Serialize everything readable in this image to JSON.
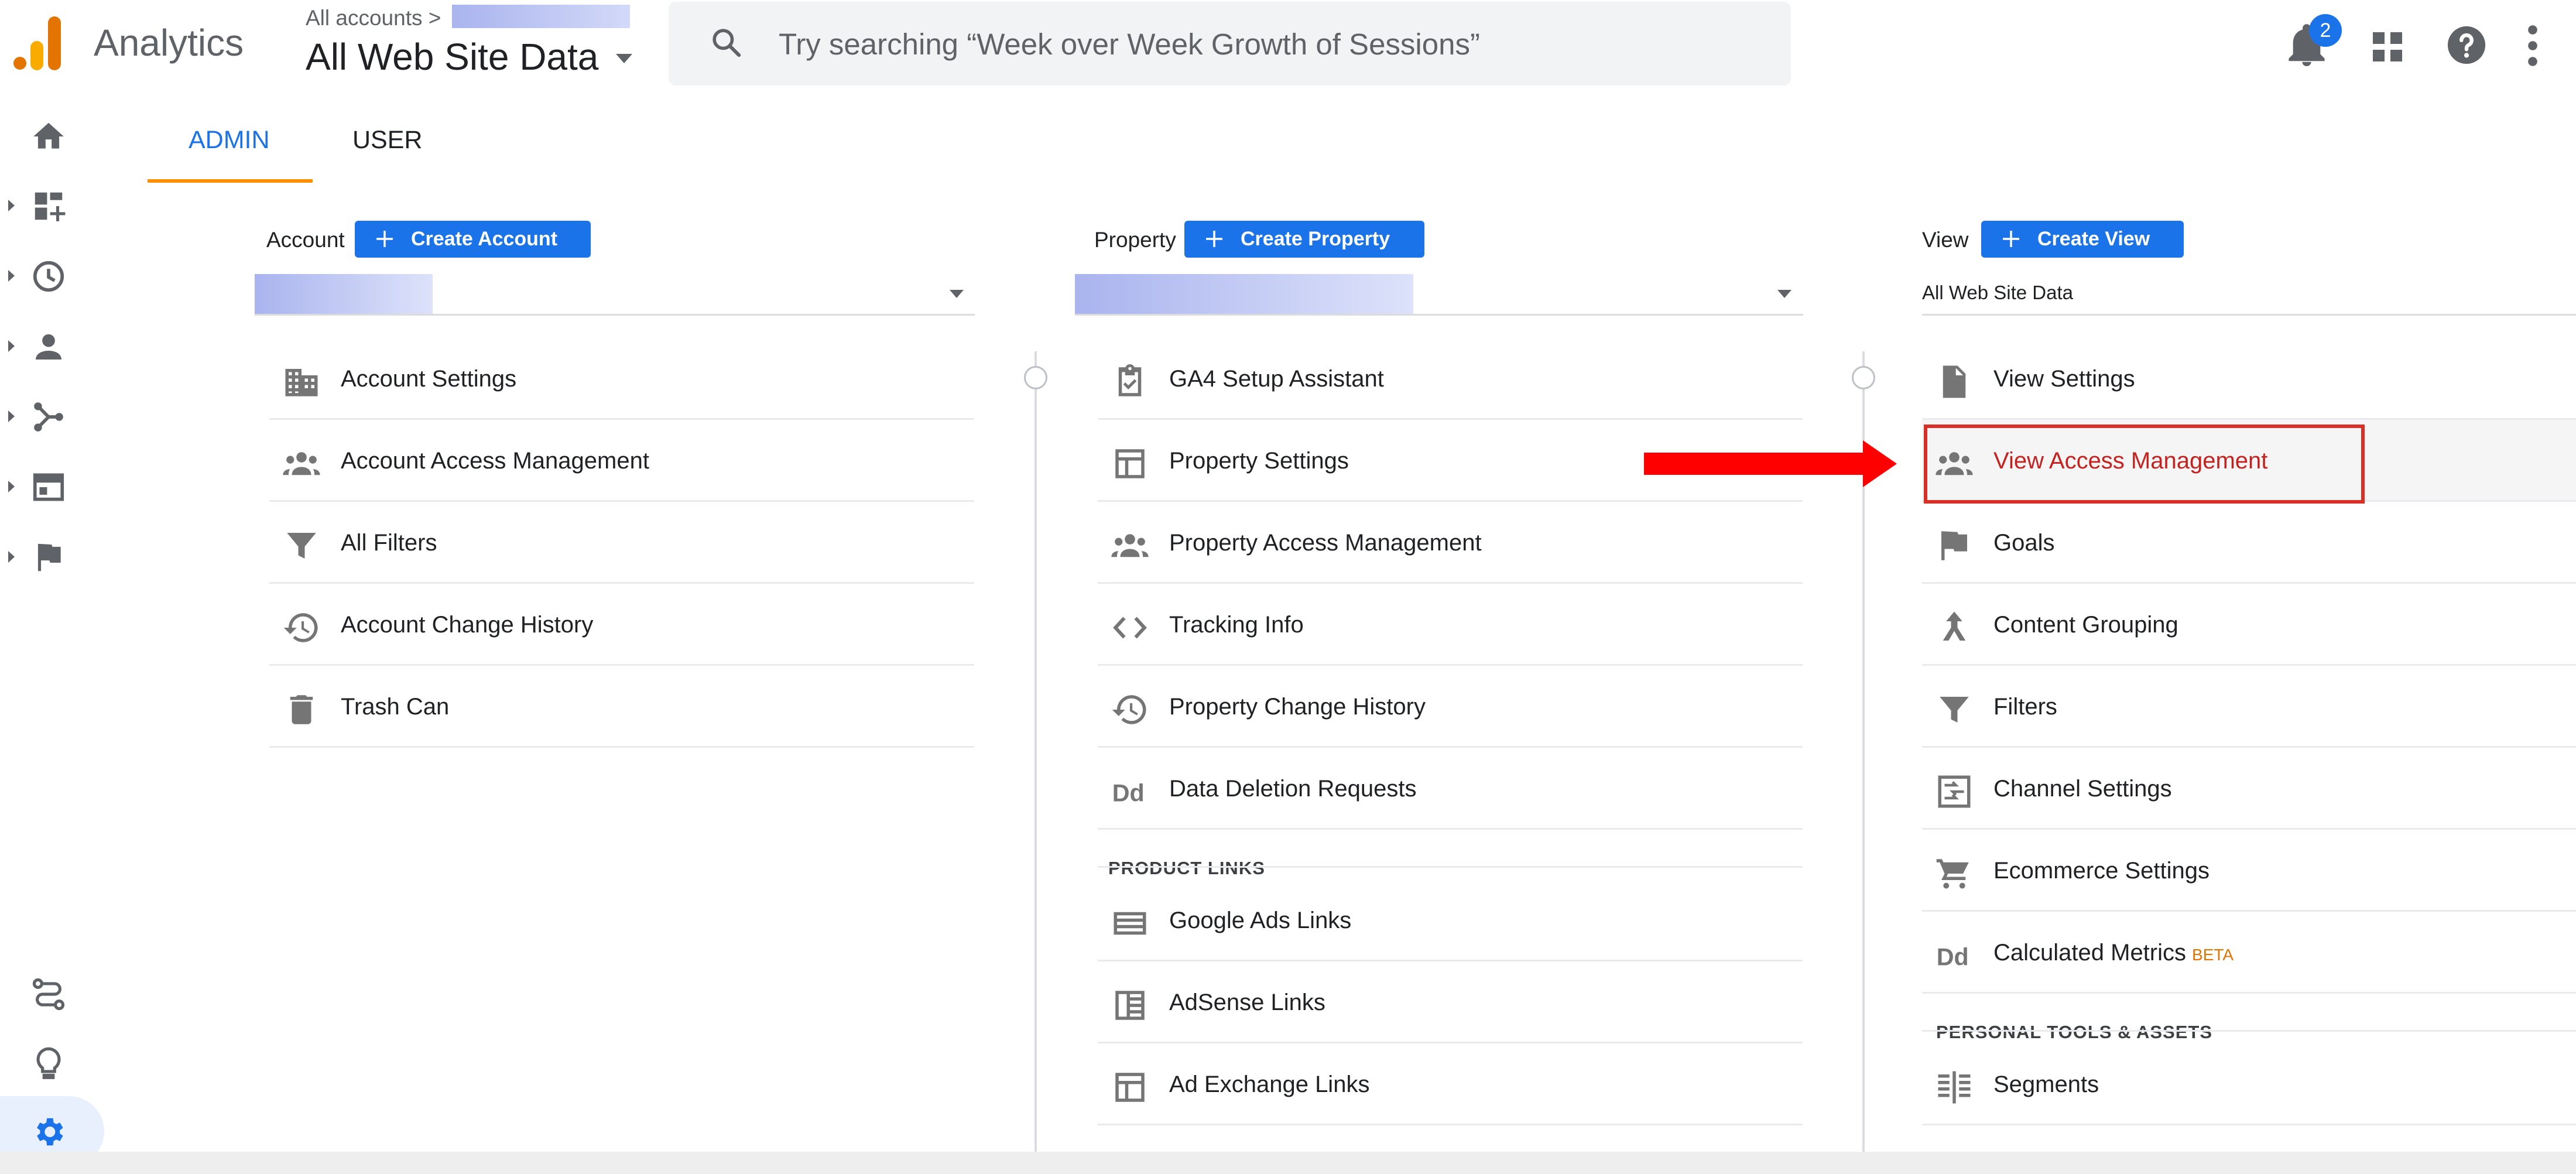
{
  "header": {
    "app_name": "Analytics",
    "breadcrumb": "All accounts >",
    "current_view": "All Web Site Data",
    "search_placeholder": "Try searching “Week over Week Growth of Sessions”",
    "notification_count": "2"
  },
  "tabs": [
    {
      "label": "ADMIN",
      "active": true
    },
    {
      "label": "USER",
      "active": false
    }
  ],
  "account_column": {
    "label": "Account",
    "create_label": "Create Account",
    "items": [
      {
        "label": "Account Settings",
        "icon": "building-icon"
      },
      {
        "label": "Account Access Management",
        "icon": "people-icon"
      },
      {
        "label": "All Filters",
        "icon": "filter-icon"
      },
      {
        "label": "Account Change History",
        "icon": "history-icon"
      },
      {
        "label": "Trash Can",
        "icon": "trash-icon"
      }
    ]
  },
  "property_column": {
    "label": "Property",
    "create_label": "Create Property",
    "items": [
      {
        "label": "GA4 Setup Assistant",
        "icon": "checklist-icon"
      },
      {
        "label": "Property Settings",
        "icon": "layout-icon"
      },
      {
        "label": "Property Access Management",
        "icon": "people-icon"
      },
      {
        "label": "Tracking Info",
        "icon": "code-icon"
      },
      {
        "label": "Property Change History",
        "icon": "history-icon"
      },
      {
        "label": "Data Deletion Requests",
        "icon": "dd-icon"
      }
    ],
    "section_title": "PRODUCT LINKS",
    "links": [
      {
        "label": "Google Ads Links",
        "icon": "ads-icon"
      },
      {
        "label": "AdSense Links",
        "icon": "adsense-icon"
      },
      {
        "label": "Ad Exchange Links",
        "icon": "adx-icon"
      }
    ]
  },
  "view_column": {
    "label": "View",
    "create_label": "Create View",
    "selected_view": "All Web Site Data",
    "items": [
      {
        "label": "View Settings",
        "icon": "document-icon"
      },
      {
        "label": "View Access Management",
        "icon": "people-icon",
        "highlighted": true
      },
      {
        "label": "Goals",
        "icon": "flag-icon"
      },
      {
        "label": "Content Grouping",
        "icon": "grouping-icon"
      },
      {
        "label": "Filters",
        "icon": "filter-icon"
      },
      {
        "label": "Channel Settings",
        "icon": "channel-icon"
      },
      {
        "label": "Ecommerce Settings",
        "icon": "cart-icon"
      },
      {
        "label": "Calculated Metrics",
        "icon": "dd-icon",
        "badge": "BETA"
      }
    ],
    "section_title": "PERSONAL TOOLS & ASSETS",
    "tools": [
      {
        "label": "Segments",
        "icon": "segments-icon"
      }
    ]
  },
  "colors": {
    "accent": "#1a73e8",
    "tab_underline": "#ff8f00",
    "highlight": "#d93025",
    "arrow": "#ff0000"
  }
}
